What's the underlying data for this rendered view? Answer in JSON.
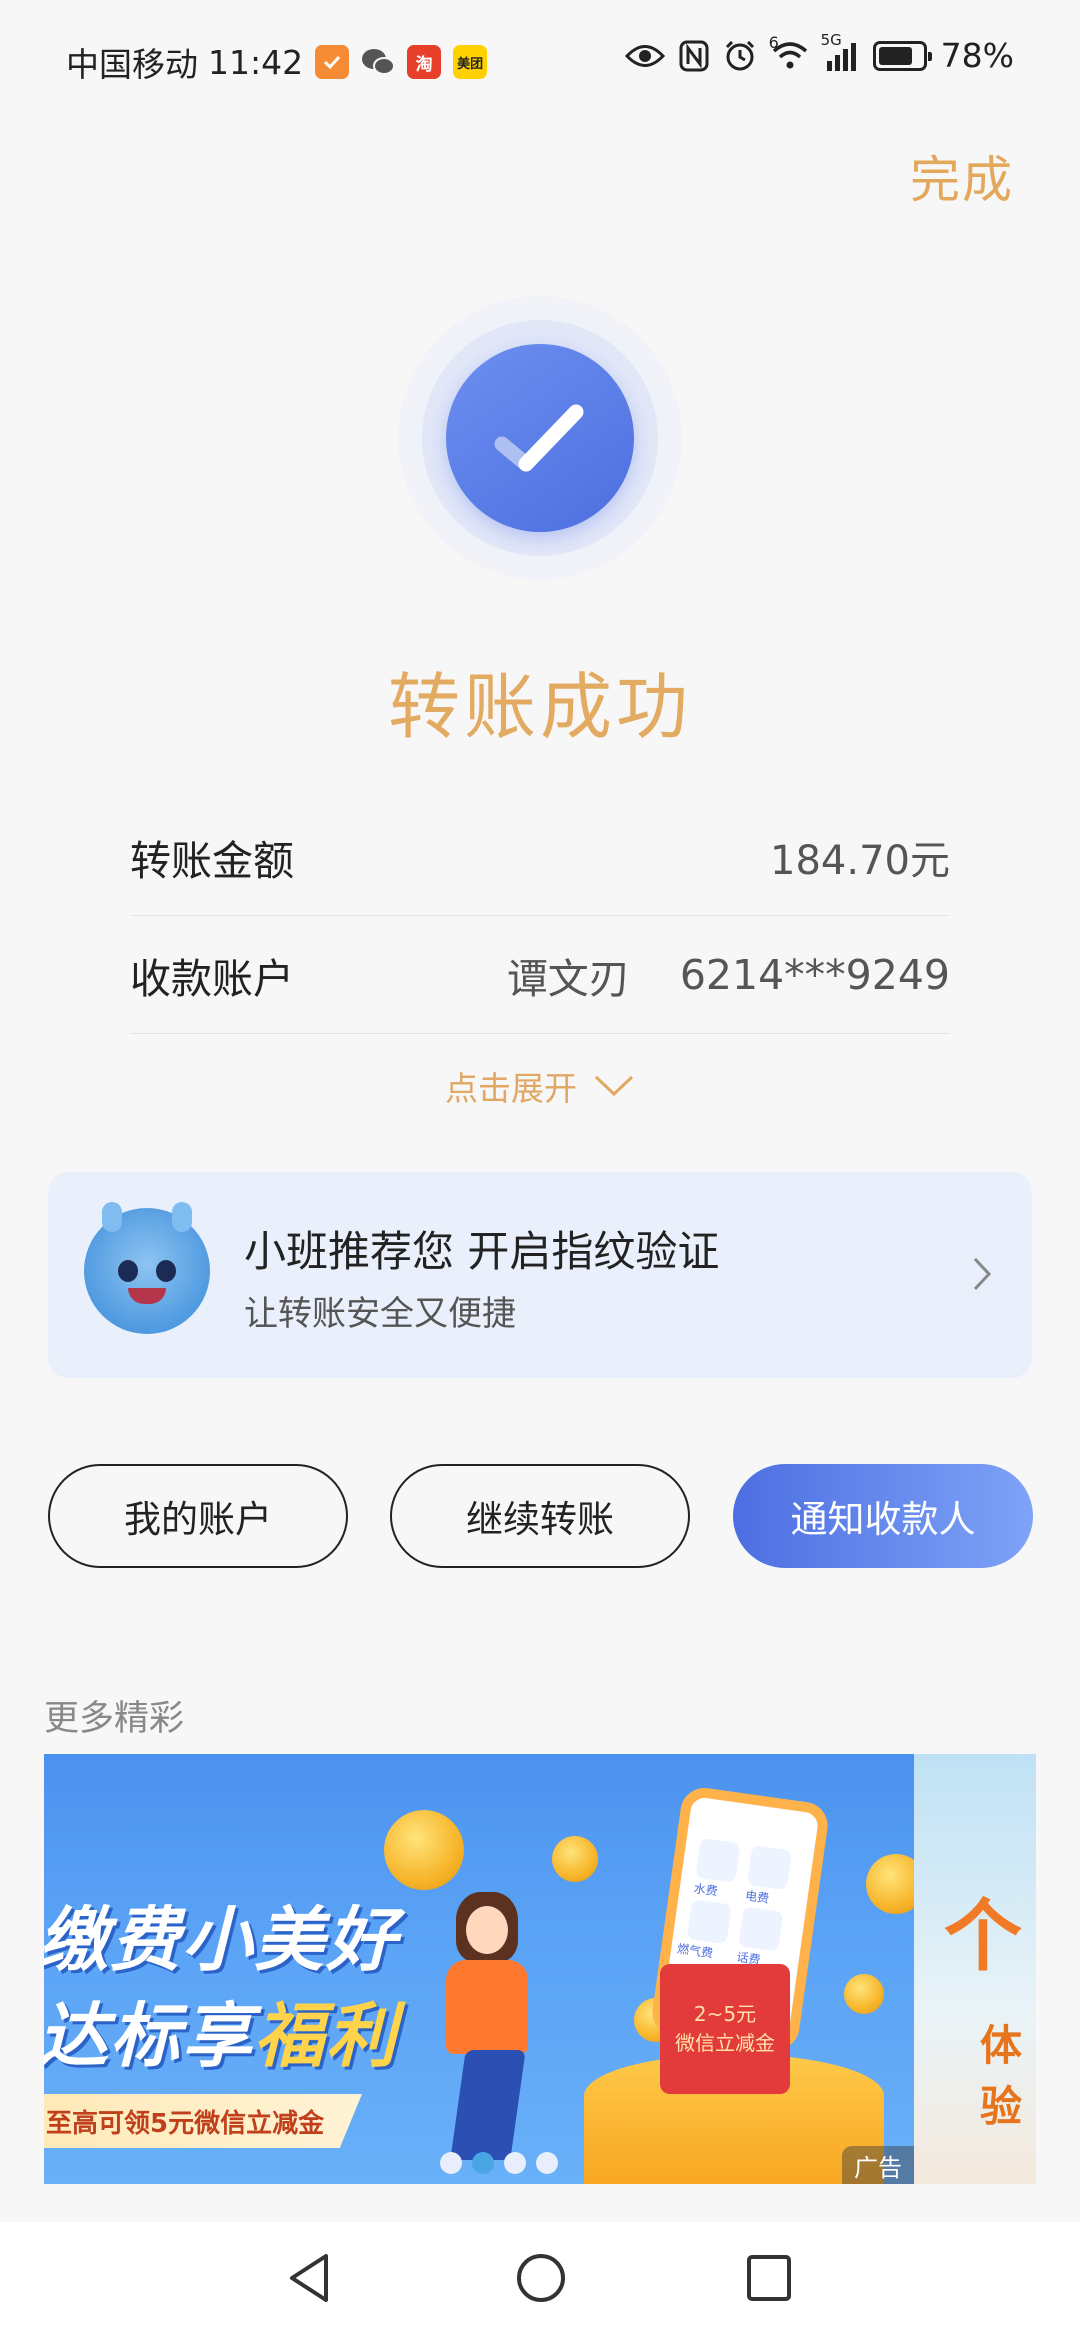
{
  "status_bar": {
    "carrier": "中国移动",
    "time": "11:42",
    "app_icons": [
      {
        "name": "checkin-icon",
        "color": "#f58b34",
        "text": ""
      },
      {
        "name": "wechat-icon",
        "color": "#555555",
        "text": ""
      },
      {
        "name": "taobao-icon",
        "color": "#e6402a",
        "text": "淘"
      },
      {
        "name": "meituan-icon",
        "color": "#ffd100",
        "text": "美团"
      }
    ],
    "signal_label_6": "6",
    "signal_label_5g": "5G",
    "battery_percent": "78%",
    "battery_level": 0.78
  },
  "header": {
    "done_label": "完成"
  },
  "result": {
    "title": "转账成功",
    "status_icon": "checkmark-icon",
    "accent_color": "#e3aa62",
    "brand_color": "#4d6ee2"
  },
  "details": {
    "amount_label": "转账金额",
    "amount_value": "184.70元",
    "payee_label": "收款账户",
    "payee_name": "谭文刃",
    "payee_account": "6214***9249",
    "expand_label": "点击展开"
  },
  "promo": {
    "title": "小班推荐您 开启指纹验证",
    "subtitle": "让转账安全又便捷"
  },
  "actions": {
    "my_account": "我的账户",
    "continue_transfer": "继续转账",
    "notify_payee": "通知收款人"
  },
  "more": {
    "title": "更多精彩",
    "banner": {
      "line1": "缴费小美好",
      "line2_prefix": "达标享",
      "line2_highlight": "福利",
      "ribbon": "至高可领5元微信立减金",
      "phone_tiles": [
        "水费",
        "电费",
        "燃气费",
        "话费"
      ],
      "envelope_amount": "2~5元",
      "envelope_caption": "微信立减金",
      "ad_tag": "广告",
      "second_banner_text": "个",
      "second_banner_sub": "体验"
    },
    "carousel_dots": 4,
    "active_dot": 1
  }
}
